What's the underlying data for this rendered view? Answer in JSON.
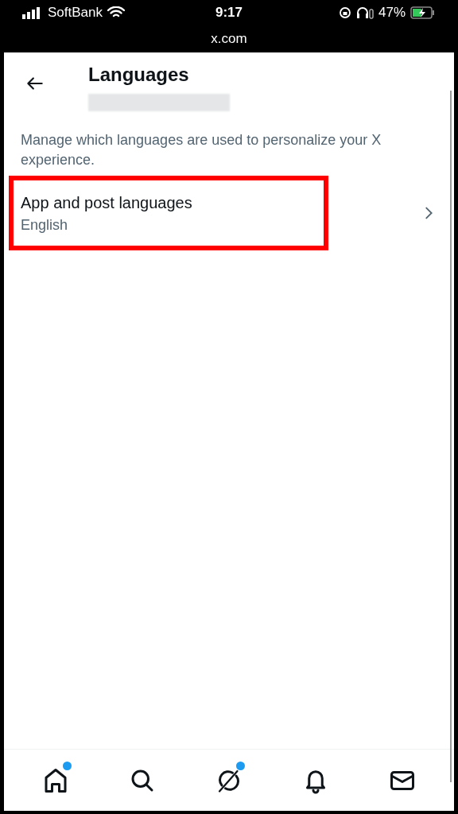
{
  "status_bar": {
    "carrier": "SoftBank",
    "time": "9:17",
    "battery": "47%",
    "url": "x.com"
  },
  "header": {
    "title": "Languages"
  },
  "description": "Manage which languages are used to personalize your X experience.",
  "settings": [
    {
      "label": "App and post languages",
      "value": "English",
      "highlighted": true
    }
  ],
  "bottom_nav": [
    {
      "kind": "home",
      "badge": true
    },
    {
      "kind": "search",
      "badge": false
    },
    {
      "kind": "grok",
      "badge": true
    },
    {
      "kind": "notifications",
      "badge": false
    },
    {
      "kind": "messages",
      "badge": false
    }
  ]
}
